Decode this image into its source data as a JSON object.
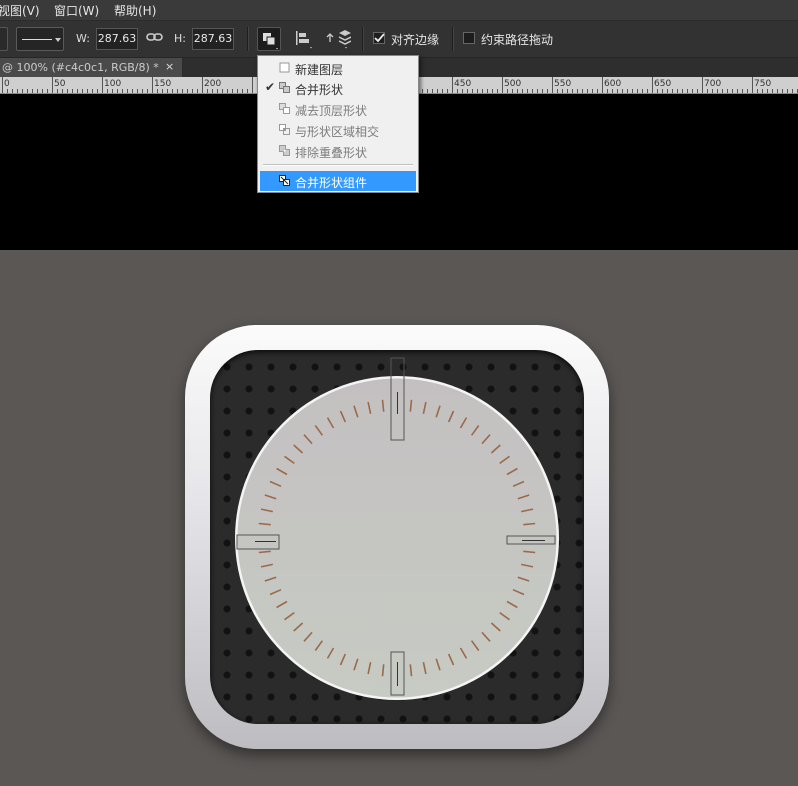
{
  "menu": {
    "items": [
      "视图(V)",
      "窗口(W)",
      "帮助(H)"
    ]
  },
  "toolbar": {
    "w_label": "W:",
    "w_value": "287.63",
    "h_label": "H:",
    "h_value": "287.63",
    "align_edges_label": "对齐边缘",
    "constrain_path_label": "约束路径拖动",
    "align_edges_checked": true,
    "constrain_path_checked": false
  },
  "document_tab": {
    "title": "@ 100% (#c4c0c1, RGB/8) *",
    "close": "×"
  },
  "ruler": {
    "labels": [
      "0",
      "50",
      "100",
      "150",
      "200",
      "450",
      "500",
      "550",
      "600",
      "650",
      "700",
      "750"
    ]
  },
  "dropdown": {
    "items": [
      {
        "label": "新建图层",
        "checked": false,
        "disabled": false,
        "highlight": false,
        "icon": "new-layer-icon"
      },
      {
        "label": "合并形状",
        "checked": true,
        "disabled": false,
        "highlight": false,
        "icon": "combine-shapes-icon"
      },
      {
        "label": "减去顶层形状",
        "checked": false,
        "disabled": true,
        "highlight": false,
        "icon": "subtract-front-shape-icon"
      },
      {
        "label": "与形状区域相交",
        "checked": false,
        "disabled": true,
        "highlight": false,
        "icon": "intersect-shape-areas-icon"
      },
      {
        "label": "排除重叠形状",
        "checked": false,
        "disabled": true,
        "highlight": false,
        "icon": "exclude-overlapping-shapes-icon"
      },
      {
        "label": "合并形状组件",
        "checked": false,
        "disabled": false,
        "highlight": true,
        "icon": "merge-shape-components-icon"
      }
    ]
  },
  "colors": {
    "highlight": "#3399ff",
    "tick": "#9a6a4a",
    "dial_top": "#c4c0c1",
    "dial_bottom": "#c6cbc3"
  },
  "clock": {
    "tick_count": 60
  }
}
